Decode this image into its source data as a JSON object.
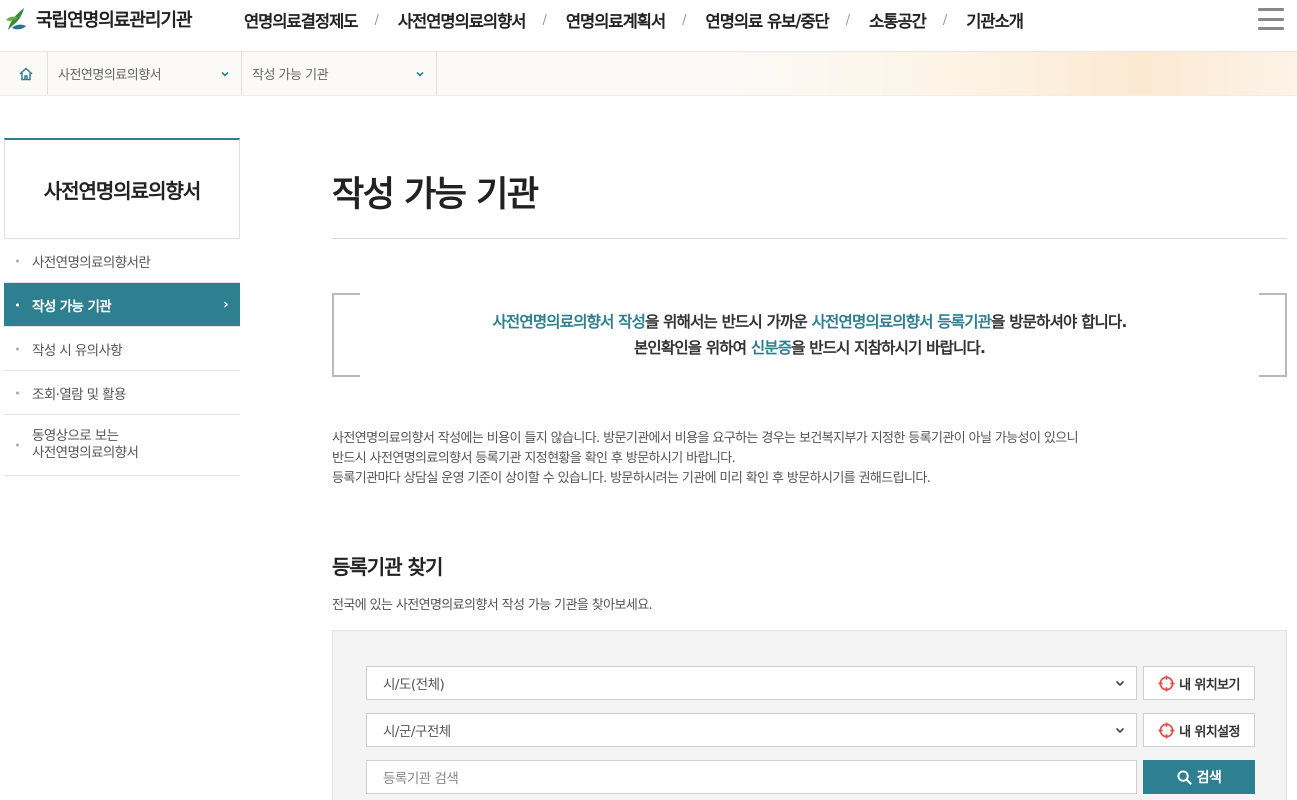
{
  "header": {
    "logo_text": "국립연명의료관리기관",
    "nav": [
      "연명의료결정제도",
      "사전연명의료의향서",
      "연명의료계획서",
      "연명의료 유보/중단",
      "소통공간",
      "기관소개"
    ],
    "nav_separator": "/"
  },
  "breadcrumb": {
    "level1": "사전연명의료의향서",
    "level2": "작성 가능 기관"
  },
  "sidebar": {
    "title": "사전연명의료의향서",
    "items": [
      {
        "label": "사전연명의료의향서란",
        "active": false
      },
      {
        "label": "작성 가능 기관",
        "active": true
      },
      {
        "label": "작성 시 유의사항",
        "active": false
      },
      {
        "label": "조회·열람 및 활용",
        "active": false
      },
      {
        "label_line1": "동영상으로 보는",
        "label_line2": "사전연명의료의향서",
        "active": false
      }
    ],
    "active_arrow": "›"
  },
  "main": {
    "title": "작성 가능 기관",
    "notice": {
      "l1_hl1": "사전연명의료의향서 작성",
      "l1_t1": "을 위해서는 반드시 가까운 ",
      "l1_hl2": "사전연명의료의향서 등록기관",
      "l1_t2": "을 방문하셔야 합니다.",
      "l2_t1": "본인확인을 위하여 ",
      "l2_hl": "신분증",
      "l2_t2": "을 반드시 지참하시기 바랍니다."
    },
    "description": [
      "사전연명의료의향서 작성에는 비용이 들지 않습니다. 방문기관에서 비용을 요구하는 경우는 보건복지부가 지정한 등록기관이 아닐 가능성이 있으니",
      "반드시 사전연명의료의향서 등록기관 지정현황을 확인 후 방문하시기 바랍니다.",
      "등록기관마다 상담실 운영 기준이 상이할 수 있습니다. 방문하시려는 기관에 미리 확인 후 방문하시기를 권해드립니다."
    ],
    "search_section": {
      "title": "등록기관 찾기",
      "subtitle": "전국에 있는 사전연명의료의향서 작성 가능 기관을 찾아보세요.",
      "sido_select": "시/도(전체)",
      "sigungu_select": "시/군/구전체",
      "keyword_placeholder": "등록기관 검색",
      "my_location_view": "내 위치보기",
      "my_location_set": "내 위치설정",
      "search_button": "검색"
    }
  },
  "colors": {
    "accent": "#2e8091",
    "locate_icon": "#e0504a",
    "bracket": "#b9b9b9"
  }
}
